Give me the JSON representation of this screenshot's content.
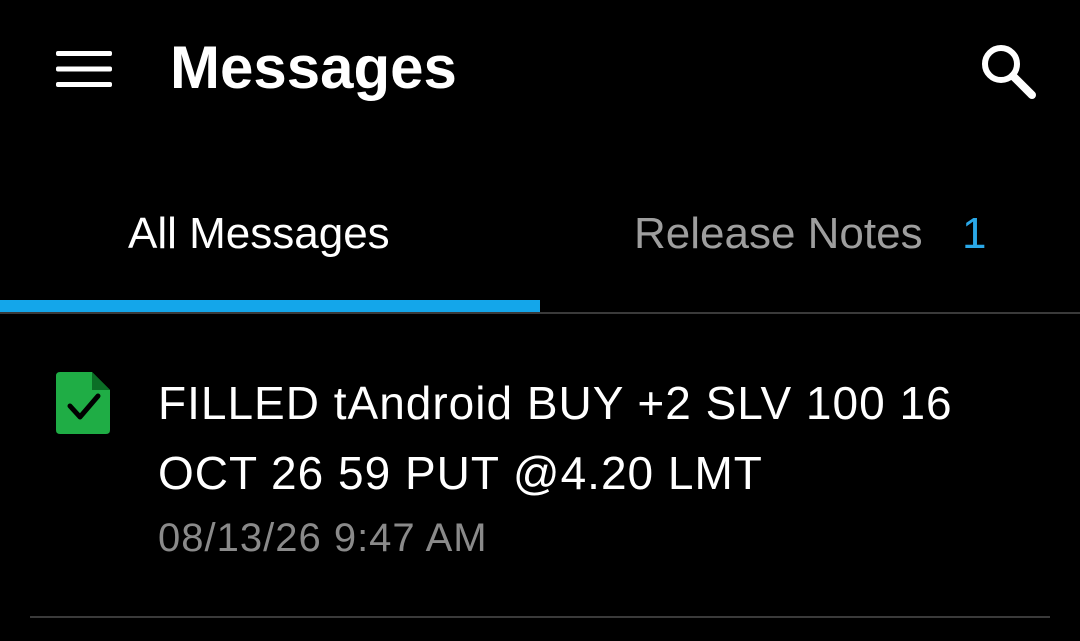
{
  "header": {
    "title": "Messages",
    "menu_icon": "hamburger-menu-icon",
    "search_icon": "search-icon"
  },
  "tabs": [
    {
      "label": "All Messages",
      "selected": true
    },
    {
      "label": "Release Notes",
      "count": "1",
      "selected": false
    }
  ],
  "colors": {
    "background": "#000000",
    "accent": "#14a6ea",
    "badge": "#2aa8e8",
    "icon_green": "#1fad45"
  },
  "messages": [
    {
      "icon": "filled-order-document-icon",
      "text": "FILLED tAndroid BUY +2 SLV 100 16 OCT 26 59 PUT @4.20 LMT",
      "timestamp": "08/13/26 9:47 AM"
    }
  ]
}
